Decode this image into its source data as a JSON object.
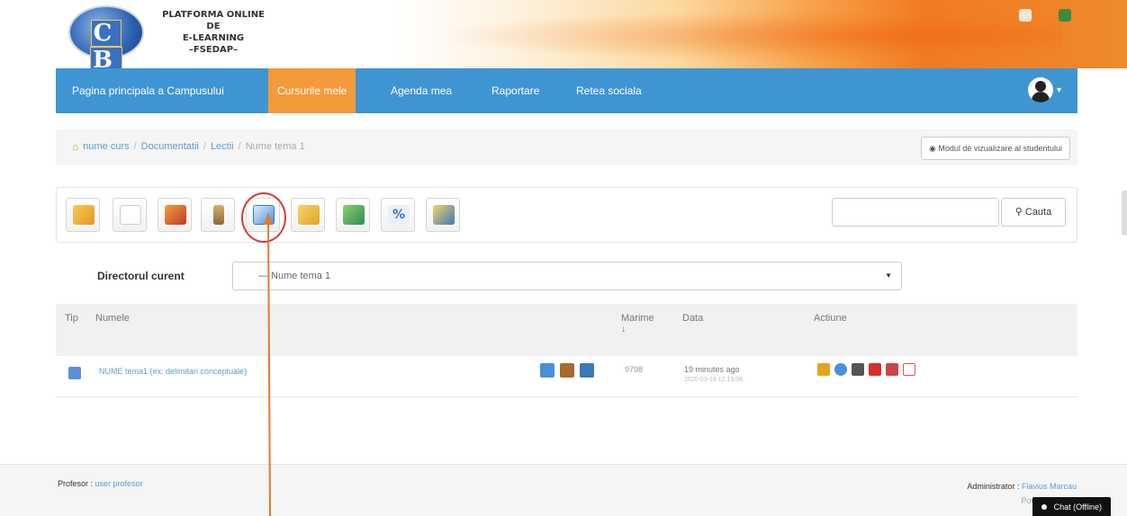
{
  "header": {
    "logo_letters": [
      "C",
      "B"
    ],
    "site_title_lines": [
      "PLATFORMA ONLINE DE",
      "E-LEARNING",
      "–FSEDAP–"
    ]
  },
  "nav": {
    "items": [
      {
        "label": "Pagina principala a Campusului",
        "active": false
      },
      {
        "label": "Cursurile mele",
        "active": true
      },
      {
        "label": "Agenda mea",
        "active": false
      },
      {
        "label": "Raportare",
        "active": false
      },
      {
        "label": "Retea sociala",
        "active": false
      }
    ],
    "colors": {
      "bar": "#3f95d1",
      "active": "#f39a3b"
    }
  },
  "breadcrumb": {
    "items": [
      "nume curs",
      "Documentatii",
      "Lectii"
    ],
    "current": "Nume tema 1"
  },
  "student_view_label": "Modul de vizualizare al studentului",
  "toolbar": {
    "icons": [
      "folder-up-icon",
      "new-document-icon",
      "draw-icon",
      "audio-record-icon",
      "upload-file-icon",
      "create-folder-icon",
      "image-gallery-icon",
      "quota-percent-icon",
      "storage-icon"
    ],
    "highlighted_icon": "upload-file-icon",
    "search_placeholder": "",
    "search_label": "Cauta"
  },
  "directory": {
    "label": "Directorul curent",
    "selected": "— Nume tema 1"
  },
  "table": {
    "headers": {
      "tip": "Tip",
      "name": "Numele",
      "size": "Marime",
      "size_sort": "↓",
      "date": "Data",
      "action": "Actiune"
    },
    "rows": [
      {
        "type_icon": "web-page-icon",
        "name": "NUME tema1 (ex: delimitari conceptuale)",
        "size": "9798",
        "date": "19 minutes ago",
        "date_full": "2020-03-19 12:13:08"
      }
    ]
  },
  "footer": {
    "left_prefix": "Profesor :",
    "left_name": "user profesor",
    "right_prefix": "Administrator :",
    "right_name": "Flavius Marcau",
    "powered_by": "Powered by Ch"
  },
  "chat_label": "Chat (Offline)"
}
